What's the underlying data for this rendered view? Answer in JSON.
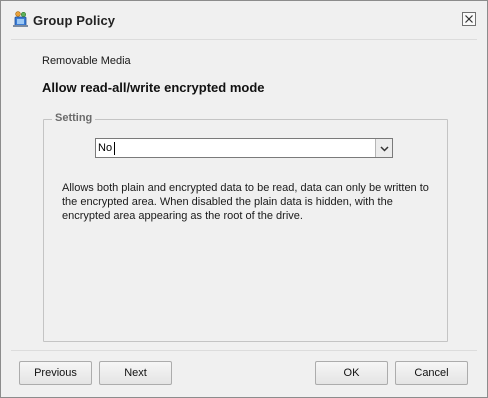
{
  "window": {
    "title": "Group Policy",
    "close_label": "×"
  },
  "policy": {
    "category": "Removable Media",
    "title": "Allow read-all/write encrypted mode"
  },
  "setting": {
    "legend": "Setting",
    "selected_value": "No",
    "description": "Allows both plain and encrypted data to be read, data can only be written to the encrypted area. When disabled the plain data is hidden, with the encrypted area appearing as the root of the drive."
  },
  "buttons": {
    "previous": "Previous",
    "next": "Next",
    "ok": "OK",
    "cancel": "Cancel"
  },
  "icons": {
    "app": "group-policy-icon",
    "close": "close-icon",
    "dropdown": "chevron-down-icon"
  }
}
